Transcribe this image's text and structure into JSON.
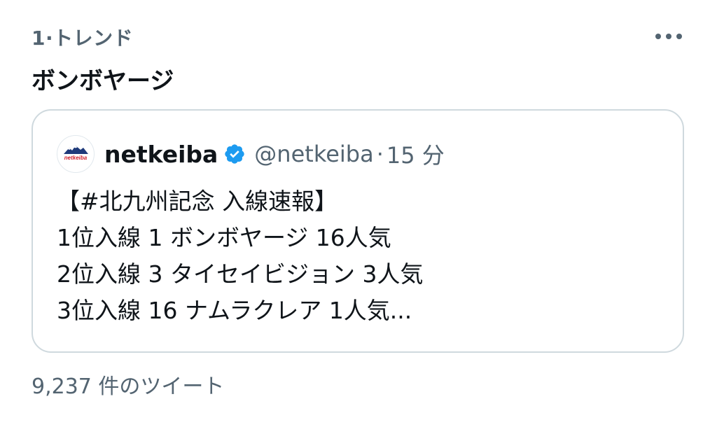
{
  "trend": {
    "meta": "1·トレンド",
    "title": "ボンボヤージ",
    "more_icon": "more-horizontal-icon"
  },
  "quote_tweet": {
    "display_name": "netkeiba",
    "avatar_text": "netkeiba",
    "verified_icon": "verified-badge-icon",
    "handle": "@netkeiba",
    "separator": "·",
    "time": "15 分",
    "lines": [
      "【#北九州記念 入線速報】",
      "1位入線 1 ボンボヤージ 16人気",
      "2位入線 3 タイセイビジョン 3人気",
      "3位入線 16 ナムラクレア 1人気..."
    ]
  },
  "tweet_count": "9,237 件のツイート",
  "colors": {
    "text_primary": "#0f1419",
    "text_secondary": "#536471",
    "border": "#cfd9de",
    "verified_blue": "#1d9bf0",
    "logo_red": "#d0202b",
    "logo_navy": "#1f3a7a"
  }
}
